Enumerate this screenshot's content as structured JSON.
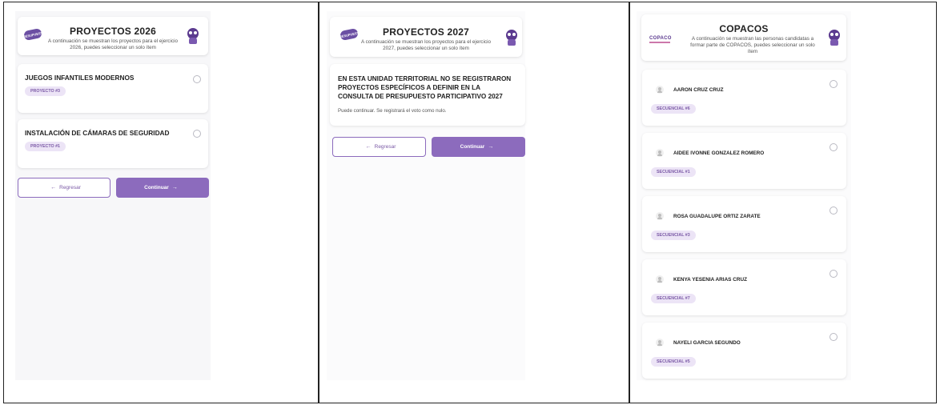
{
  "panels": {
    "p2026": {
      "title": "PROYECTOS 2026",
      "subtitle_line1": "A continuación se muestran los proyectos para el ejercicio",
      "subtitle_line2": "2026, puedes seleccionar un solo ítem",
      "logo_text": "PRESUPUESTO",
      "projects": [
        {
          "name": "JUEGOS INFANTILES MODERNOS",
          "tag": "PROYECTO #3"
        },
        {
          "name": "INSTALACIÓN DE CÁMARAS DE SEGURIDAD",
          "tag": "PROYECTO #1"
        }
      ],
      "back_label": "Regresar",
      "next_label": "Continuar"
    },
    "p2027": {
      "title": "PROYECTOS 2027",
      "subtitle_line1": "A continuación se muestran los proyectos para el ejercicio",
      "subtitle_line2": "2027, puedes seleccionar un solo ítem",
      "logo_text": "PRESUPUESTO",
      "message_lines": [
        "EN ESTA UNIDAD TERRITORIAL NO SE REGISTRARON",
        "PROYECTOS ESPECÍFICOS A DEFINIR EN LA",
        "CONSULTA DE PRESUPUESTO PARTICIPATIVO 2027"
      ],
      "message_sub": "Puede continuar. Se registrará el voto como nulo.",
      "back_label": "Regresar",
      "next_label": "Continuar"
    },
    "copacos": {
      "title": "COPACOS",
      "subtitle_line1": "A continuación se muestran las personas candidatas a",
      "subtitle_line2": "formar parte de COPACOS, puedes seleccionar un solo",
      "subtitle_line3": "ítem",
      "logo_text": "COPACO",
      "candidates": [
        {
          "name": "AARON CRUZ CRUZ",
          "tag": "SECUENCIAL #6"
        },
        {
          "name": "AIDEE IVONNE GONZALEZ ROMERO",
          "tag": "SECUENCIAL #1"
        },
        {
          "name": "ROSA GUADALUPE ORTIZ ZARATE",
          "tag": "SECUENCIAL #3"
        },
        {
          "name": "KENYA YESENIA ARIAS CRUZ",
          "tag": "SECUENCIAL #7"
        },
        {
          "name": "NAYELI GARCIA SEGUNDO",
          "tag": "SECUENCIAL #5"
        }
      ]
    }
  },
  "colors": {
    "accent": "#8c6bbd",
    "pill_bg": "#ece4f6",
    "pill_text": "#7b5aa6"
  },
  "icons": {
    "back": "arrow-left-icon",
    "next": "arrow-right-icon",
    "mascot": "mascot-icon",
    "avatar": "user-avatar-icon"
  }
}
